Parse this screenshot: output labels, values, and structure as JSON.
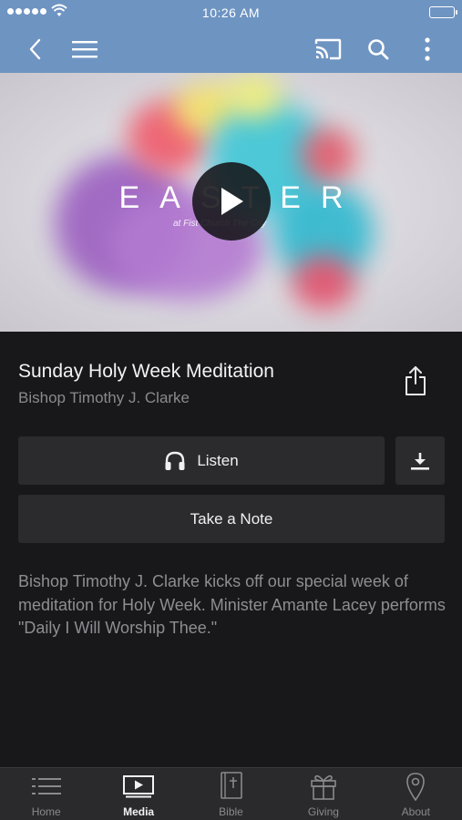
{
  "status_bar": {
    "time": "10:26 AM"
  },
  "nav": {
    "icons": [
      "back-icon",
      "menu-icon",
      "cast-icon",
      "search-icon",
      "more-vertical-icon"
    ],
    "color": "#6e94c2"
  },
  "hero": {
    "title": "EASTER",
    "subtitle": "at Fist Church The City"
  },
  "media": {
    "title": "Sunday Holy Week Meditation",
    "speaker": "Bishop Timothy J. Clarke",
    "listen_label": "Listen",
    "note_label": "Take a Note",
    "description": "Bishop Timothy J. Clarke kicks off our special week of meditation for Holy Week. Minister Amante Lacey performs \"Daily I Will Worship Thee.\""
  },
  "tabs": [
    {
      "label": "Home",
      "icon": "list-icon",
      "active": false
    },
    {
      "label": "Media",
      "icon": "media-play-icon",
      "active": true
    },
    {
      "label": "Bible",
      "icon": "bible-icon",
      "active": false
    },
    {
      "label": "Giving",
      "icon": "gift-icon",
      "active": false
    },
    {
      "label": "About",
      "icon": "location-pin-icon",
      "active": false
    }
  ]
}
